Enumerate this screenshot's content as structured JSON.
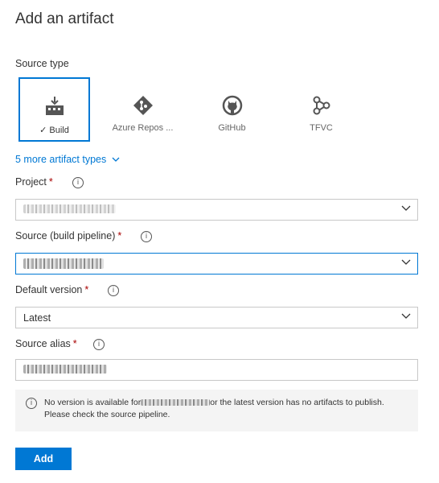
{
  "panel": {
    "title": "Add an artifact"
  },
  "source_type": {
    "label": "Source type",
    "tiles": [
      {
        "label": "Build",
        "icon": "build-icon",
        "selected": true
      },
      {
        "label": "Azure Repos ...",
        "icon": "azure-repos-icon",
        "selected": false
      },
      {
        "label": "GitHub",
        "icon": "github-icon",
        "selected": false
      },
      {
        "label": "TFVC",
        "icon": "tfvc-icon",
        "selected": false
      }
    ],
    "more_link": "5 more artifact types"
  },
  "project": {
    "label": "Project",
    "required_mark": "*",
    "value": ""
  },
  "source": {
    "label": "Source (build pipeline)",
    "required_mark": "*",
    "value": ""
  },
  "default_version": {
    "label": "Default version",
    "required_mark": "*",
    "value": "Latest"
  },
  "source_alias": {
    "label": "Source alias",
    "required_mark": "*",
    "value": ""
  },
  "notice": {
    "text_before": "No version is available for",
    "text_after": "or the latest version has no artifacts to publish.",
    "line2": "Please check the source pipeline."
  },
  "actions": {
    "add_label": "Add"
  },
  "colors": {
    "accent": "#0078d4",
    "required": "#a80000",
    "notice_bg": "#f4f4f4"
  }
}
